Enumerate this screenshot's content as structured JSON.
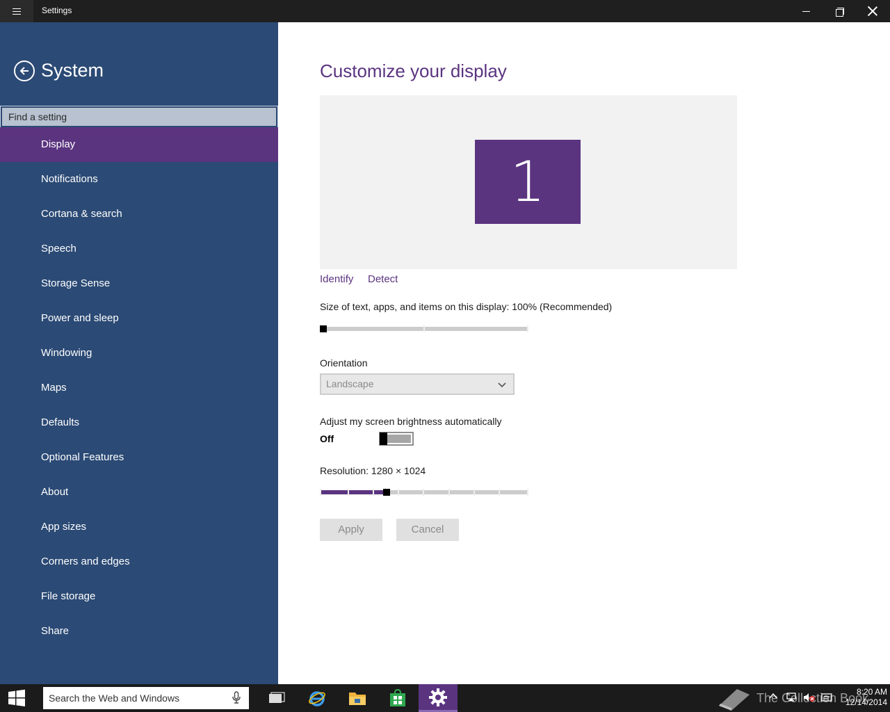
{
  "window": {
    "title": "Settings"
  },
  "sidebar": {
    "title": "System",
    "search_placeholder": "Find a setting",
    "items": [
      {
        "label": "Display",
        "selected": true
      },
      {
        "label": "Notifications"
      },
      {
        "label": "Cortana & search"
      },
      {
        "label": "Speech"
      },
      {
        "label": "Storage Sense"
      },
      {
        "label": "Power and sleep"
      },
      {
        "label": "Windowing"
      },
      {
        "label": "Maps"
      },
      {
        "label": "Defaults"
      },
      {
        "label": "Optional Features"
      },
      {
        "label": "About"
      },
      {
        "label": "App sizes"
      },
      {
        "label": "Corners and edges"
      },
      {
        "label": "File storage"
      },
      {
        "label": "Share"
      }
    ]
  },
  "main": {
    "title": "Customize your display",
    "monitor_number": "1",
    "identify_label": "Identify",
    "detect_label": "Detect",
    "scale_label": "Size of text, apps, and items on this display: 100% (Recommended)",
    "scale_level": 0,
    "orientation_label": "Orientation",
    "orientation_value": "Landscape",
    "brightness_label": "Adjust my screen brightness automatically",
    "brightness_state": "Off",
    "resolution_label": "Resolution: 1280 × 1024",
    "resolution_level": 0.32,
    "apply_label": "Apply",
    "cancel_label": "Cancel"
  },
  "taskbar": {
    "search_placeholder": "Search the Web and Windows",
    "watermark": "The Collection Book",
    "time": "8:20 AM",
    "date": "12/14/2014"
  },
  "colors": {
    "accent": "#5b3480",
    "sidebar": "#2b4a75",
    "titlebar": "#1f1f1f",
    "taskbar": "#1b1b1b"
  }
}
